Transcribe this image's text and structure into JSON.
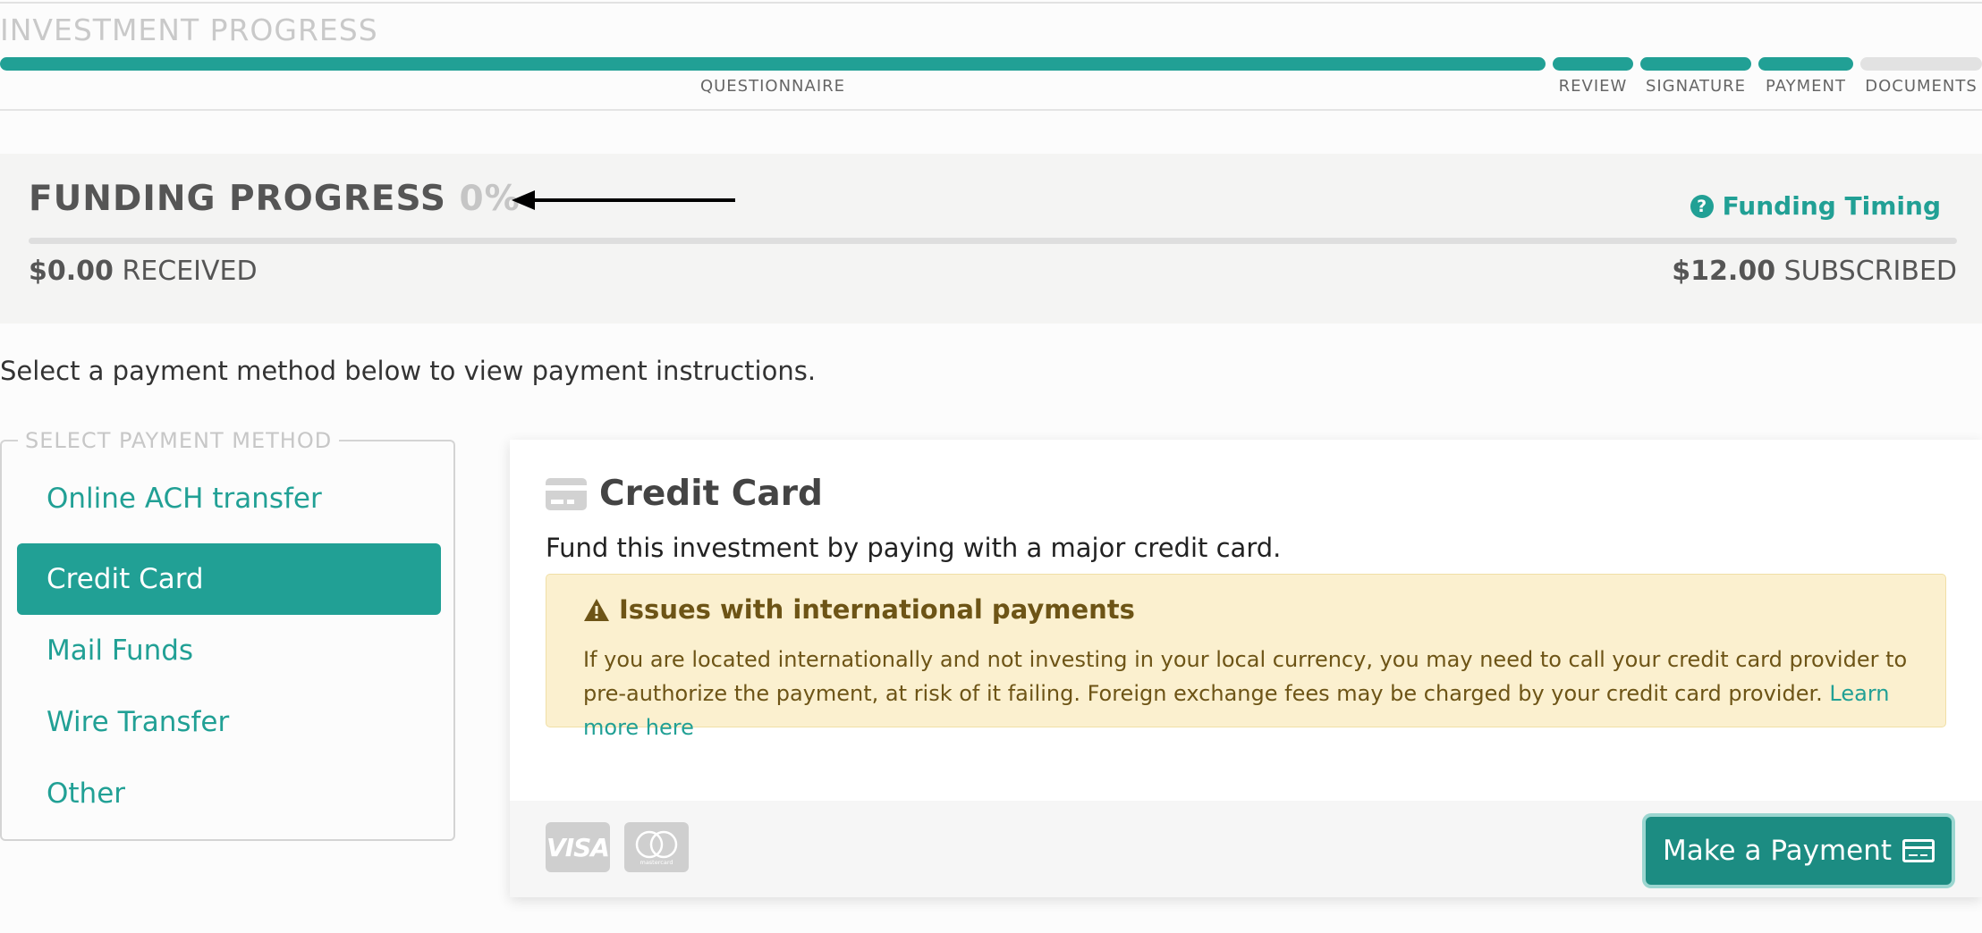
{
  "progress": {
    "title": "INVESTMENT PROGRESS",
    "steps": [
      {
        "label": "QUESTIONNAIRE",
        "done": true
      },
      {
        "label": "REVIEW",
        "done": true
      },
      {
        "label": "SIGNATURE",
        "done": true
      },
      {
        "label": "PAYMENT",
        "done": true
      },
      {
        "label": "DOCUMENTS",
        "done": false
      }
    ]
  },
  "funding": {
    "title": "FUNDING PROGRESS",
    "percent": "0%",
    "percent_value": 0,
    "timing_label": "Funding Timing",
    "received_amount": "$0.00",
    "received_label": "RECEIVED",
    "subscribed_amount": "$12.00",
    "subscribed_label": "SUBSCRIBED"
  },
  "instructions": "Select a payment method below to view payment instructions.",
  "methods": {
    "legend": "SELECT PAYMENT METHOD",
    "items": [
      {
        "label": "Online ACH transfer",
        "active": false
      },
      {
        "label": "Credit Card",
        "active": true
      },
      {
        "label": "Mail Funds",
        "active": false
      },
      {
        "label": "Wire Transfer",
        "active": false
      },
      {
        "label": "Other",
        "active": false
      }
    ]
  },
  "card": {
    "title": "Credit Card",
    "description": "Fund this investment by paying with a major credit card.",
    "warning_title": "Issues with international payments",
    "warning_text": "If you are located internationally and not investing in your local currency, you may need to call your credit card provider to pre-authorize the payment, at risk of it failing. Foreign exchange fees may be charged by your credit card provider.",
    "learn_more": "Learn more here",
    "visa_logo": "VISA",
    "mastercard_logo": "mastercard",
    "pay_button": "Make a Payment"
  },
  "colors": {
    "accent": "#21a095",
    "button": "#1c8c82",
    "warning_bg": "#fbf0cf",
    "warning_text": "#6d5416"
  }
}
